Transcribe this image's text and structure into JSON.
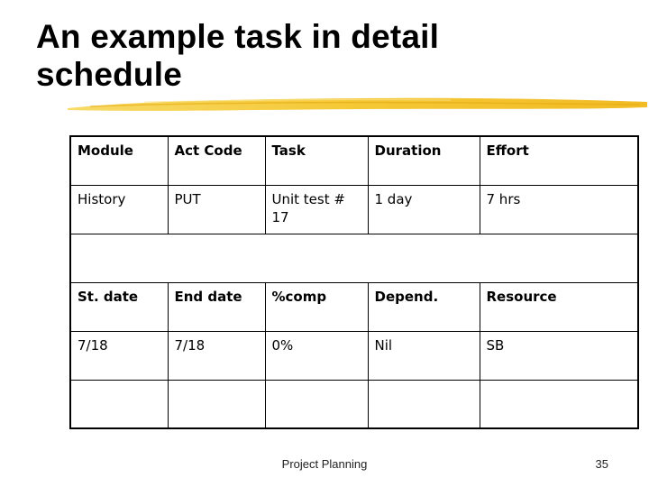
{
  "slide": {
    "title_line1": "An example task in detail",
    "title_line2": "schedule",
    "accent_color": "#f2c31c",
    "footer": "Project Planning",
    "page_number": "35"
  },
  "table": {
    "header1": [
      "Module",
      "Act Code",
      "Task",
      "Duration",
      "Effort"
    ],
    "row1": [
      "History",
      "PUT",
      "Unit test # 17",
      "1 day",
      "7 hrs"
    ],
    "merged_row": "",
    "header2": [
      "St. date",
      "End date",
      "%comp",
      "Depend.",
      "Resource"
    ],
    "row2": [
      "7/18",
      "7/18",
      "0%",
      "Nil",
      "SB"
    ],
    "row3": [
      "",
      "",
      "",
      "",
      ""
    ]
  }
}
